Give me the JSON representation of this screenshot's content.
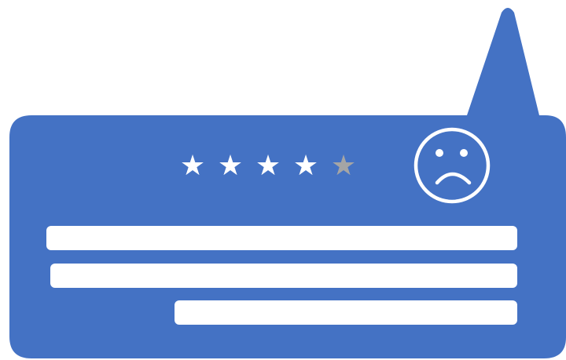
{
  "colors": {
    "bubble": "#4472c4",
    "bar": "#ffffff",
    "star_filled": "#ffffff",
    "star_empty": "#a5a5a5",
    "face": "#ffffff"
  },
  "review": {
    "rating": 4,
    "max_rating": 5,
    "star_glyph": "★",
    "face_icon": "sad-face-icon",
    "text_line_count": 3
  }
}
